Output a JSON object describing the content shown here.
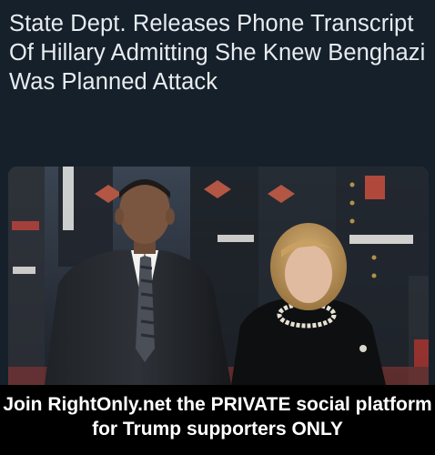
{
  "post": {
    "headline": "State Dept. Releases Phone Transcript Of Hillary Admitting She Knew Benghazi Was Planned Attack"
  },
  "banner": {
    "text": "Join RightOnly.net the PRIVATE social platform for Trump supporters ONLY"
  },
  "colors": {
    "background": "#15202b",
    "headline_text": "#e8ecef",
    "banner_background": "#000000",
    "banner_text": "#ffffff"
  }
}
